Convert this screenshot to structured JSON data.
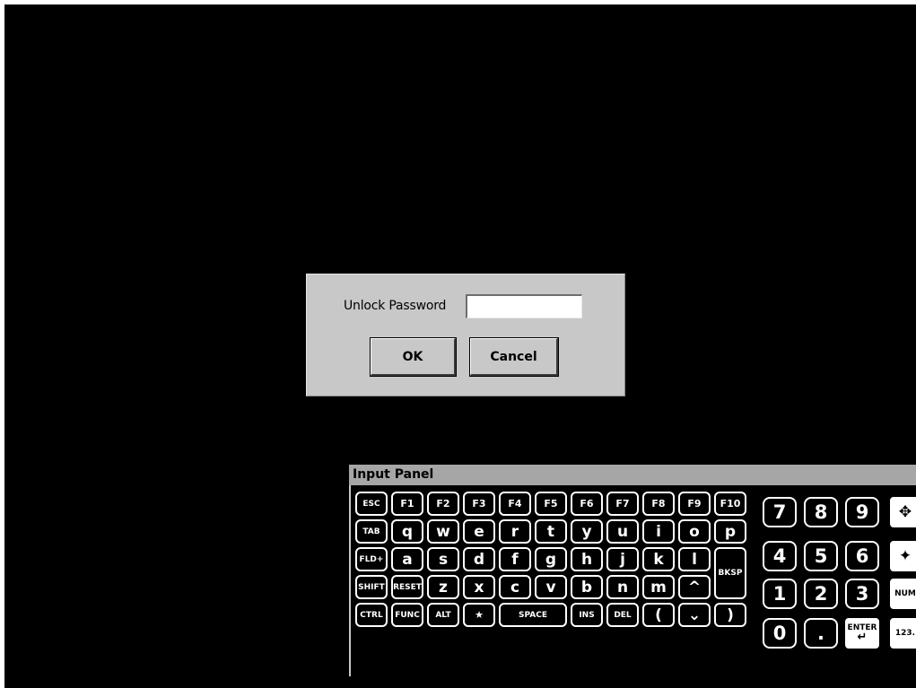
{
  "dialog": {
    "label": "Unlock Password",
    "password_value": "",
    "ok_label": "OK",
    "cancel_label": "Cancel"
  },
  "panel": {
    "title": "Input Panel",
    "keys": {
      "esc": "ESC",
      "f1": "F1",
      "f2": "F2",
      "f3": "F3",
      "f4": "F4",
      "f5": "F5",
      "f6": "F6",
      "f7": "F7",
      "f8": "F8",
      "f9": "F9",
      "f10": "F10",
      "tab": "TAB",
      "q": "q",
      "w": "w",
      "e": "e",
      "r": "r",
      "t": "t",
      "y": "y",
      "u": "u",
      "i": "i",
      "o": "o",
      "p": "p",
      "fld": "FLD+",
      "a": "a",
      "s": "s",
      "d": "d",
      "f": "f",
      "g": "g",
      "h": "h",
      "j": "j",
      "k": "k",
      "l": "l",
      "bksp": "BKSP",
      "shift": "SHIFT",
      "reset": "RESET",
      "z": "z",
      "x": "x",
      "c": "c",
      "v": "v",
      "b": "b",
      "n": "n",
      "m": "m",
      "up": "^",
      "ctrl": "CTRL",
      "func": "FUNC",
      "alt": "ALT",
      "star": "★",
      "space": "SPACE",
      "ins": "INS",
      "del": "DEL",
      "left": "(",
      "down": "⌄",
      "right": ")",
      "n7": "7",
      "n8": "8",
      "n9": "9",
      "n4": "4",
      "n5": "5",
      "n6": "6",
      "n1": "1",
      "n2": "2",
      "n3": "3",
      "n0": "0",
      "dot": ".",
      "enter": "ENTER",
      "enter_arrow": "↵",
      "move": "✥",
      "resize": "✦",
      "num": "NUM",
      "n123": "123."
    }
  }
}
